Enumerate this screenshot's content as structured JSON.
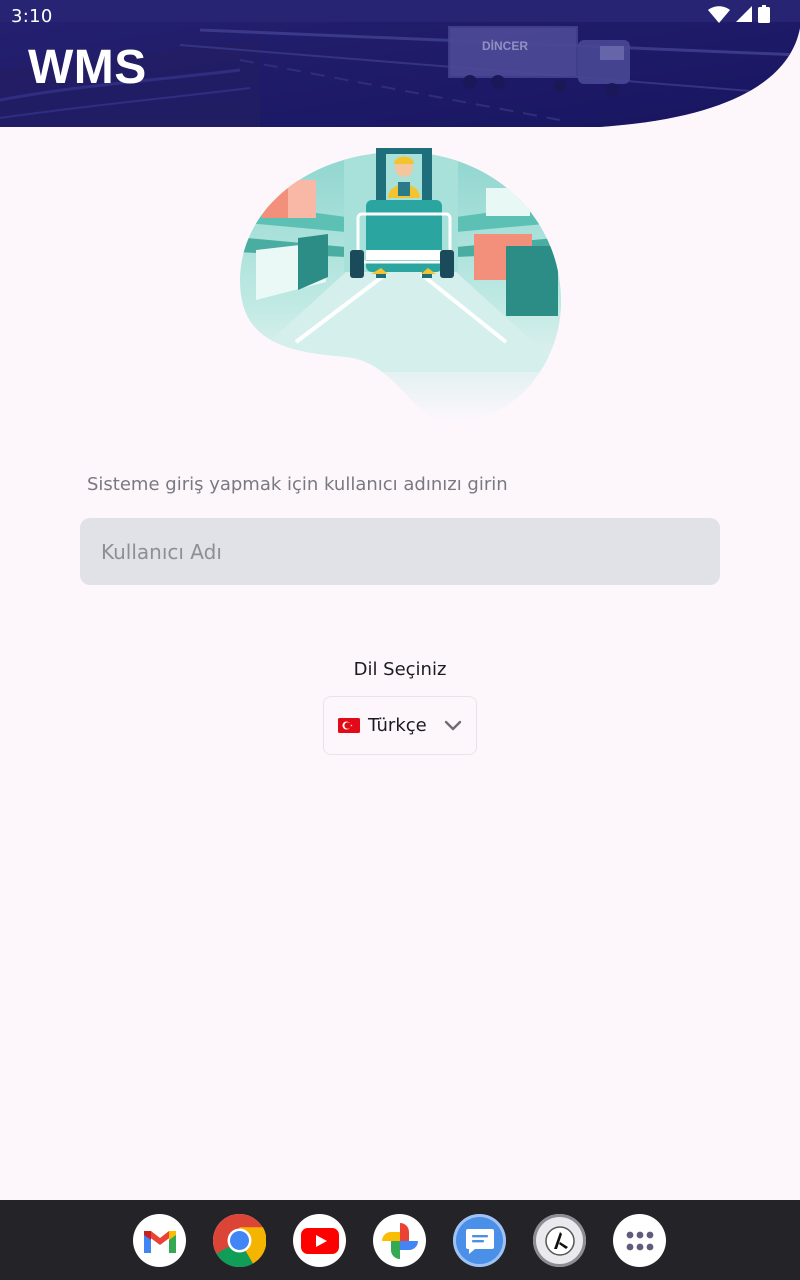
{
  "status_bar": {
    "time": "3:10",
    "icons": [
      "wifi-icon",
      "signal-icon",
      "battery-icon"
    ]
  },
  "header": {
    "title": "WMS",
    "truck_text": "DİNCER",
    "colors": {
      "overlay": "#1e1a6b",
      "accent": "#ffffff"
    }
  },
  "login": {
    "instruction": "Sisteme giriş yapmak için kullanıcı adınızı girin",
    "username_value": "",
    "username_placeholder": "Kullanıcı Adı"
  },
  "language": {
    "label": "Dil Seçiniz",
    "selected": "Türkçe",
    "flag": "turkey-flag-icon"
  },
  "dock": {
    "apps": [
      "gmail-icon",
      "chrome-icon",
      "youtube-icon",
      "photos-icon",
      "messages-icon",
      "custom-app-icon",
      "app-drawer-icon"
    ]
  }
}
